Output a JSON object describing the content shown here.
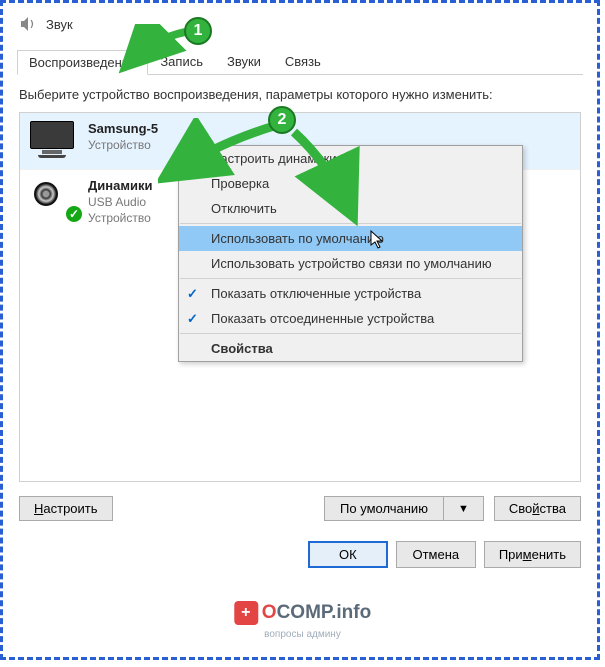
{
  "window": {
    "title": "Звук"
  },
  "tabs": {
    "playback": "Воспроизведение",
    "recording": "Запись",
    "sounds": "Звуки",
    "communications": "Связь"
  },
  "instruction": "Выберите устройство воспроизведения, параметры которого нужно изменить:",
  "devices": [
    {
      "name": "Samsung-5",
      "desc": "Устройство"
    },
    {
      "name": "Динамики",
      "desc1": "USB Audio",
      "desc2": "Устройство"
    }
  ],
  "context_menu": {
    "configure_speakers": "Настроить динамики",
    "test": "Проверка",
    "disable": "Отключить",
    "set_default": "Использовать по умолчанию",
    "set_default_comm": "Использовать устройство связи по умолчанию",
    "show_disabled": "Показать отключенные устройства",
    "show_disconnected": "Показать отсоединенные устройства",
    "properties": "Свойства"
  },
  "buttons": {
    "configure": "Настроить",
    "set_default": "По умолчанию",
    "properties": "Свойства",
    "ok": "ОК",
    "cancel": "Отмена",
    "apply": "Применить"
  },
  "annotations": {
    "b1": "1",
    "b2": "2"
  },
  "watermark": {
    "brand_first": "O",
    "brand_rest": "COMP.info",
    "sub": "вопросы админу"
  }
}
